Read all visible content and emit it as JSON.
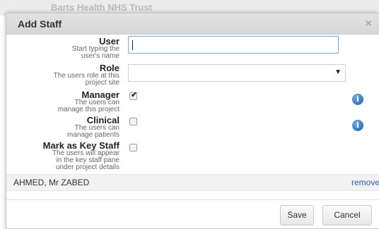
{
  "background": {
    "org_name": "Barts Health NHS Trust"
  },
  "dialog": {
    "title": "Add Staff",
    "close_glyph": "×"
  },
  "form": {
    "user": {
      "label": "User",
      "hint_1": "Start typing the",
      "hint_2": "user's name",
      "value": ""
    },
    "role": {
      "label": "Role",
      "hint_1": "The users role at this",
      "hint_2": "project site",
      "value": ""
    },
    "manager": {
      "label": "Manager",
      "hint_1": "The users can",
      "hint_2": "manage this project",
      "checked": true
    },
    "clinical": {
      "label": "Clinical",
      "hint_1": "The users can",
      "hint_2": "manage patients",
      "checked": false
    },
    "key_staff": {
      "label": "Mark as Key Staff",
      "hint_1": "The users will appear",
      "hint_2": "in the key staff pane",
      "hint_3": "under project details",
      "checked": false
    }
  },
  "staff_list": [
    {
      "name": "AHMED, Mr ZABED",
      "action": "remove"
    }
  ],
  "buttons": {
    "save": "Save",
    "cancel": "Cancel"
  },
  "icons": {
    "info": "info-icon",
    "close": "close-icon",
    "dropdown": "chevron-down-icon",
    "check": "checkmark-icon"
  },
  "colors": {
    "info_blue": "#1d5fa8",
    "link": "#2a5da8",
    "input_focus": "#7aa7d9"
  }
}
